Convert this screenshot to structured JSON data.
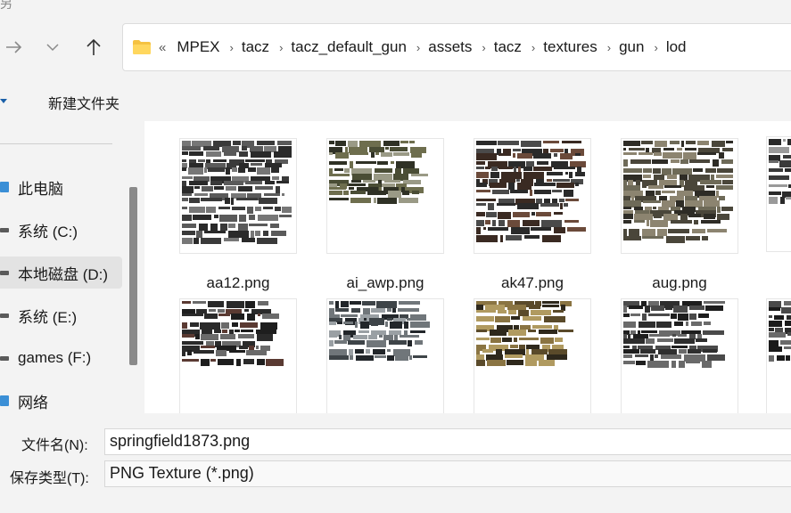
{
  "window": {
    "title_fragment": "另"
  },
  "nav": {
    "path_overflow": "«"
  },
  "breadcrumb": [
    "MPEX",
    "tacz",
    "tacz_default_gun",
    "assets",
    "tacz",
    "textures",
    "gun",
    "lod"
  ],
  "toolbar": {
    "new_folder_label": "新建文件夹"
  },
  "sidebar": {
    "items": [
      {
        "label": "此电脑",
        "icon": "pc-icon"
      },
      {
        "label": "系统 (C:)",
        "icon": "drive-icon"
      },
      {
        "label": "本地磁盘 (D:)",
        "icon": "drive-icon",
        "selected": true
      },
      {
        "label": "系统 (E:)",
        "icon": "drive-icon"
      },
      {
        "label": "games (F:)",
        "icon": "drive-icon"
      },
      {
        "label": "网络",
        "icon": "network-icon"
      }
    ]
  },
  "files": [
    {
      "name": "aa12.png",
      "palette": [
        "#3a3a3a",
        "#5a5a5a",
        "#2a2a2a",
        "#777777"
      ]
    },
    {
      "name": "ai_awp.png",
      "palette": [
        "#4a4d35",
        "#6e6e4e",
        "#2f3125",
        "#9a9a86"
      ]
    },
    {
      "name": "ak47.png",
      "palette": [
        "#3a2a22",
        "#4a4a4a",
        "#2a2a2a",
        "#6b4a3a"
      ]
    },
    {
      "name": "aug.png",
      "palette": [
        "#4a463a",
        "#6e6a58",
        "#2e2c26",
        "#8c8470"
      ]
    },
    {
      "name": "",
      "palette": [
        "#3a3a3a",
        "#6a6a6a",
        "#2a2a2a",
        "#9a9a9a"
      ]
    },
    {
      "name": "",
      "palette": [
        "#2a2a2a",
        "#5a3a32",
        "#1e1e1e",
        "#6a6a6a"
      ]
    },
    {
      "name": "",
      "palette": [
        "#3e4448",
        "#70767a",
        "#22262a",
        "#9aa0a4"
      ]
    },
    {
      "name": "",
      "palette": [
        "#5a4a2a",
        "#8a7442",
        "#2e281c",
        "#b09a60"
      ]
    },
    {
      "name": "",
      "palette": [
        "#1e1e1e",
        "#4a4a4a",
        "#2e2e2e",
        "#6a6a6a"
      ]
    },
    {
      "name": "",
      "palette": [
        "#2a2a2a",
        "#4a4a4a",
        "#1a1a1a",
        "#6a6a6a"
      ]
    }
  ],
  "footer": {
    "filename_label": "文件名(N):",
    "filename_value": "springfield1873.png",
    "type_label": "保存类型(T):",
    "type_value": "PNG Texture (*.png)"
  }
}
